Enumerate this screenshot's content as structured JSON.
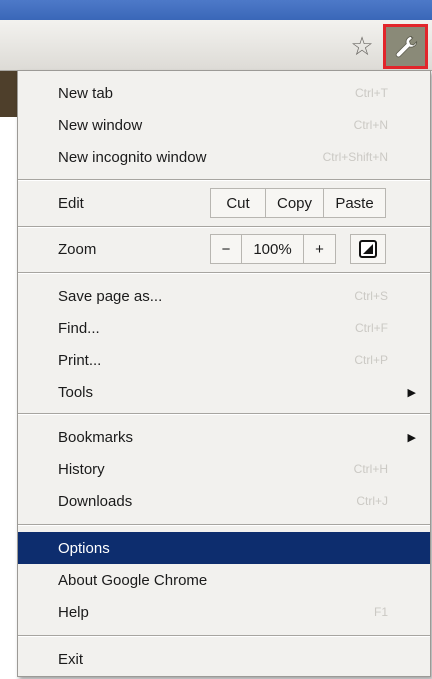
{
  "menu": {
    "group1": [
      {
        "label": "New tab",
        "shortcut": "Ctrl+T"
      },
      {
        "label": "New window",
        "shortcut": "Ctrl+N"
      },
      {
        "label": "New incognito window",
        "shortcut": "Ctrl+Shift+N"
      }
    ],
    "edit": {
      "label": "Edit",
      "cut": "Cut",
      "copy": "Copy",
      "paste": "Paste"
    },
    "zoom": {
      "label": "Zoom",
      "minus": "−",
      "value": "100%",
      "plus": "+"
    },
    "group3": [
      {
        "label": "Save page as...",
        "shortcut": "Ctrl+S"
      },
      {
        "label": "Find...",
        "shortcut": "Ctrl+F"
      },
      {
        "label": "Print...",
        "shortcut": "Ctrl+P"
      },
      {
        "label": "Tools",
        "submenu_arrow": "▶"
      }
    ],
    "group4": [
      {
        "label": "Bookmarks",
        "submenu_arrow": "▶"
      },
      {
        "label": "History",
        "shortcut": "Ctrl+H"
      },
      {
        "label": "Downloads",
        "shortcut": "Ctrl+J"
      }
    ],
    "group5": [
      {
        "label": "Options"
      },
      {
        "label": "About Google Chrome"
      },
      {
        "label": "Help",
        "shortcut": "F1"
      }
    ],
    "exit": {
      "label": "Exit"
    }
  },
  "toolbar": {
    "star_icon": "☆"
  },
  "colors": {
    "selection": "#0d2d6e",
    "highlight_border": "#e2252b",
    "wrench_bg": "#8a8a78"
  }
}
